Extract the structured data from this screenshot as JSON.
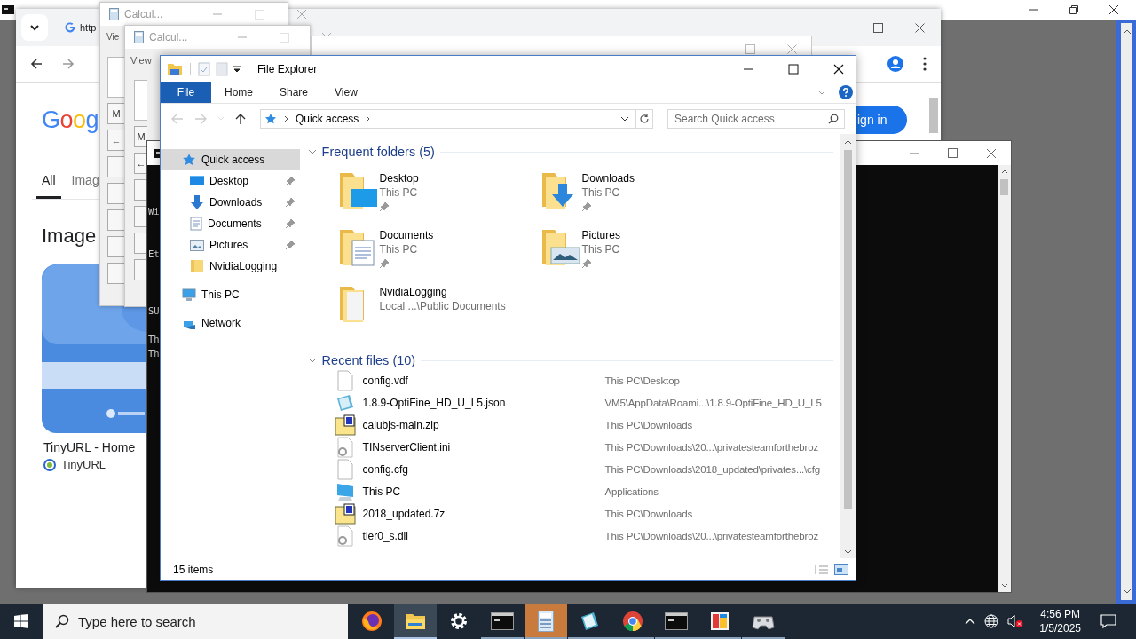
{
  "browser": {
    "address_text": "http",
    "logo": "Goog",
    "sign_in": "ign in",
    "tabs": [
      {
        "label": "All",
        "selected": true
      },
      {
        "label": "Imag",
        "selected": false
      }
    ],
    "section_title": "Image",
    "result": {
      "kind": "picture",
      "title": "TinyURL - Home",
      "source": "TinyURL"
    }
  },
  "calculators": [
    {
      "title": "Calcul...",
      "menu": "Vie",
      "keys": [
        "M",
        "←"
      ]
    },
    {
      "title": "Calcul...",
      "menu": "View",
      "keys": [
        "M",
        "←"
      ]
    }
  ],
  "terminal": {
    "lines": [
      "Wi",
      "Et",
      "SU",
      "Th",
      "Th"
    ]
  },
  "explorer": {
    "title": "File Explorer",
    "ribbon_tabs": [
      {
        "label": "File",
        "selected": true
      },
      {
        "label": "Home",
        "selected": false
      },
      {
        "label": "Share",
        "selected": false
      },
      {
        "label": "View",
        "selected": false
      }
    ],
    "address": "Quick access",
    "search_placeholder": "Search Quick access",
    "nav": [
      {
        "label": "Quick access",
        "kind": "quick",
        "selected": true,
        "children": [
          {
            "label": "Desktop",
            "kind": "desktop",
            "pinned": true,
            "selected": false
          },
          {
            "label": "Downloads",
            "kind": "downloads",
            "pinned": true,
            "selected": false
          },
          {
            "label": "Documents",
            "kind": "documents",
            "pinned": true,
            "selected": false
          },
          {
            "label": "Pictures",
            "kind": "pictures",
            "pinned": true,
            "selected": false
          },
          {
            "label": "NvidiaLogging",
            "kind": "folder",
            "pinned": false,
            "selected": false
          }
        ]
      },
      {
        "label": "This PC",
        "kind": "pc",
        "selected": false
      },
      {
        "label": "Network",
        "kind": "network",
        "selected": false
      }
    ],
    "frequent_header": "Frequent folders (5)",
    "frequent": [
      {
        "name": "Desktop",
        "location": "This PC",
        "kind": "desktop",
        "pinned": true
      },
      {
        "name": "Downloads",
        "location": "This PC",
        "kind": "downloads",
        "pinned": true
      },
      {
        "name": "Documents",
        "location": "This PC",
        "kind": "documents",
        "pinned": true
      },
      {
        "name": "Pictures",
        "location": "This PC",
        "kind": "pictures",
        "pinned": true
      },
      {
        "name": "NvidiaLogging",
        "location": "Local ...\\Public Documents",
        "kind": "folder",
        "pinned": false
      }
    ],
    "recent_header": "Recent files (10)",
    "recent": [
      {
        "name": "config.vdf",
        "path": "This PC\\Desktop",
        "kind": "file"
      },
      {
        "name": "1.8.9-OptiFine_HD_U_L5.json",
        "path": "VM5\\AppData\\Roami...\\1.8.9-OptiFine_HD_U_L5",
        "kind": "json"
      },
      {
        "name": "calubjs-main.zip",
        "path": "This PC\\Downloads",
        "kind": "archive"
      },
      {
        "name": "TINserverClient.ini",
        "path": "This PC\\Downloads\\20...\\privatesteamforthebroz",
        "kind": "settings"
      },
      {
        "name": "config.cfg",
        "path": "This PC\\Downloads\\2018_updated\\privates...\\cfg",
        "kind": "file"
      },
      {
        "name": "This PC",
        "path": "Applications",
        "kind": "pc"
      },
      {
        "name": "2018_updated.7z",
        "path": "This PC\\Downloads",
        "kind": "archive"
      },
      {
        "name": "tier0_s.dll",
        "path": "This PC\\Downloads\\20...\\privatesteamforthebroz",
        "kind": "settings"
      }
    ],
    "status": "15 items"
  },
  "taskbar": {
    "search_placeholder": "Type here to search",
    "apps": [
      {
        "kind": "firefox",
        "open": false,
        "selected": false,
        "flashing": false
      },
      {
        "kind": "explorer",
        "open": true,
        "selected": true,
        "flashing": false
      },
      {
        "kind": "settings",
        "open": false,
        "selected": false,
        "flashing": false
      },
      {
        "kind": "terminal",
        "open": true,
        "selected": false,
        "flashing": false
      },
      {
        "kind": "calculator",
        "open": true,
        "selected": false,
        "flashing": true
      },
      {
        "kind": "notes",
        "open": true,
        "selected": false,
        "flashing": false
      },
      {
        "kind": "chrome",
        "open": true,
        "selected": false,
        "flashing": false
      },
      {
        "kind": "terminal",
        "open": true,
        "selected": false,
        "flashing": false
      },
      {
        "kind": "paint",
        "open": true,
        "selected": false,
        "flashing": false
      },
      {
        "kind": "controller",
        "open": true,
        "selected": false,
        "flashing": false
      }
    ],
    "time": "4:56 PM",
    "date": "1/5/2025"
  }
}
